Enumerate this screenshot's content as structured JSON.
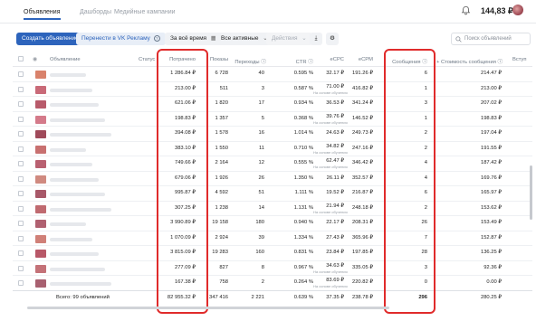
{
  "topbar": {
    "tabs": [
      "Объявления",
      "Дашборды",
      "Медийные кампании"
    ],
    "balance": "144,83 ₽"
  },
  "toolbar": {
    "create": "Создать объявление",
    "transfer": "Перенести в VK Рекламу",
    "period": "За всё время",
    "filter": "Все активные",
    "actions": "Действия",
    "search_placeholder": "Поиск объявлений"
  },
  "columns": {
    "ad": "Объявление",
    "status": "Статус",
    "spent": "Потрачено",
    "impressions": "Показы",
    "clicks": "Переходы",
    "ctr": "CTR",
    "ecpc": "eCPC",
    "ecpm": "eCPM",
    "messages": "Сообщения",
    "msg_cost": "Стоимость сообщения",
    "join": "Вступ"
  },
  "ecpc_note": "На основе обучения",
  "rows": [
    {
      "spent": "1 286.84 ₽",
      "impressions": "6 728",
      "clicks": "40",
      "ctr": "0.595 %",
      "ecpc": "32.17 ₽",
      "ecpm": "191.26 ₽",
      "messages": "6",
      "msg_cost": "214.47 ₽",
      "note": false
    },
    {
      "spent": "213.00 ₽",
      "impressions": "511",
      "clicks": "3",
      "ctr": "0.587 %",
      "ecpc": "71.00 ₽",
      "ecpm": "416.82 ₽",
      "messages": "1",
      "msg_cost": "213.00 ₽",
      "note": true
    },
    {
      "spent": "621.06 ₽",
      "impressions": "1 820",
      "clicks": "17",
      "ctr": "0.934 %",
      "ecpc": "36.53 ₽",
      "ecpm": "341.24 ₽",
      "messages": "3",
      "msg_cost": "207.02 ₽",
      "note": false
    },
    {
      "spent": "198.83 ₽",
      "impressions": "1 357",
      "clicks": "5",
      "ctr": "0.368 %",
      "ecpc": "39.76 ₽",
      "ecpm": "146.52 ₽",
      "messages": "1",
      "msg_cost": "198.83 ₽",
      "note": true
    },
    {
      "spent": "394.08 ₽",
      "impressions": "1 578",
      "clicks": "16",
      "ctr": "1.014 %",
      "ecpc": "24.63 ₽",
      "ecpm": "249.73 ₽",
      "messages": "2",
      "msg_cost": "197.04 ₽",
      "note": false
    },
    {
      "spent": "383.10 ₽",
      "impressions": "1 550",
      "clicks": "11",
      "ctr": "0.710 %",
      "ecpc": "34.82 ₽",
      "ecpm": "247.16 ₽",
      "messages": "2",
      "msg_cost": "191.55 ₽",
      "note": true
    },
    {
      "spent": "749.66 ₽",
      "impressions": "2 164",
      "clicks": "12",
      "ctr": "0.555 %",
      "ecpc": "62.47 ₽",
      "ecpm": "346.42 ₽",
      "messages": "4",
      "msg_cost": "187.42 ₽",
      "note": true
    },
    {
      "spent": "679.06 ₽",
      "impressions": "1 926",
      "clicks": "26",
      "ctr": "1.350 %",
      "ecpc": "26.11 ₽",
      "ecpm": "352.57 ₽",
      "messages": "4",
      "msg_cost": "169.76 ₽",
      "note": false
    },
    {
      "spent": "995.87 ₽",
      "impressions": "4 592",
      "clicks": "51",
      "ctr": "1.111 %",
      "ecpc": "19.52 ₽",
      "ecpm": "216.87 ₽",
      "messages": "6",
      "msg_cost": "165.97 ₽",
      "note": false
    },
    {
      "spent": "307.25 ₽",
      "impressions": "1 238",
      "clicks": "14",
      "ctr": "1.131 %",
      "ecpc": "21.94 ₽",
      "ecpm": "248.18 ₽",
      "messages": "2",
      "msg_cost": "153.62 ₽",
      "note": true
    },
    {
      "spent": "3 990.89 ₽",
      "impressions": "19 158",
      "clicks": "180",
      "ctr": "0.940 %",
      "ecpc": "22.17 ₽",
      "ecpm": "208.31 ₽",
      "messages": "26",
      "msg_cost": "153.49 ₽",
      "note": false
    },
    {
      "spent": "1 070.09 ₽",
      "impressions": "2 924",
      "clicks": "39",
      "ctr": "1.334 %",
      "ecpc": "27.43 ₽",
      "ecpm": "365.96 ₽",
      "messages": "7",
      "msg_cost": "152.87 ₽",
      "note": false
    },
    {
      "spent": "3 815.09 ₽",
      "impressions": "19 283",
      "clicks": "160",
      "ctr": "0.831 %",
      "ecpc": "23.84 ₽",
      "ecpm": "197.85 ₽",
      "messages": "28",
      "msg_cost": "136.25 ₽",
      "note": false
    },
    {
      "spent": "277.09 ₽",
      "impressions": "827",
      "clicks": "8",
      "ctr": "0.967 %",
      "ecpc": "34.63 ₽",
      "ecpm": "335.05 ₽",
      "messages": "3",
      "msg_cost": "92.36 ₽",
      "note": true
    },
    {
      "spent": "167.38 ₽",
      "impressions": "758",
      "clicks": "2",
      "ctr": "0.264 %",
      "ecpc": "83.69 ₽",
      "ecpm": "220.82 ₽",
      "messages": "0",
      "msg_cost": "0.00 ₽",
      "note": true
    }
  ],
  "totals": {
    "label": "Всего: 99 объявлений",
    "spent": "82 955.32 ₽",
    "impressions": "347 416",
    "clicks": "2 221",
    "ctr": "0.639 %",
    "ecpc": "37.35 ₽",
    "ecpm": "238.78 ₽",
    "messages": "296",
    "msg_cost": "280.25 ₽"
  },
  "colors": {
    "accent": "#2d64bc",
    "highlight": "#e02b2b"
  }
}
